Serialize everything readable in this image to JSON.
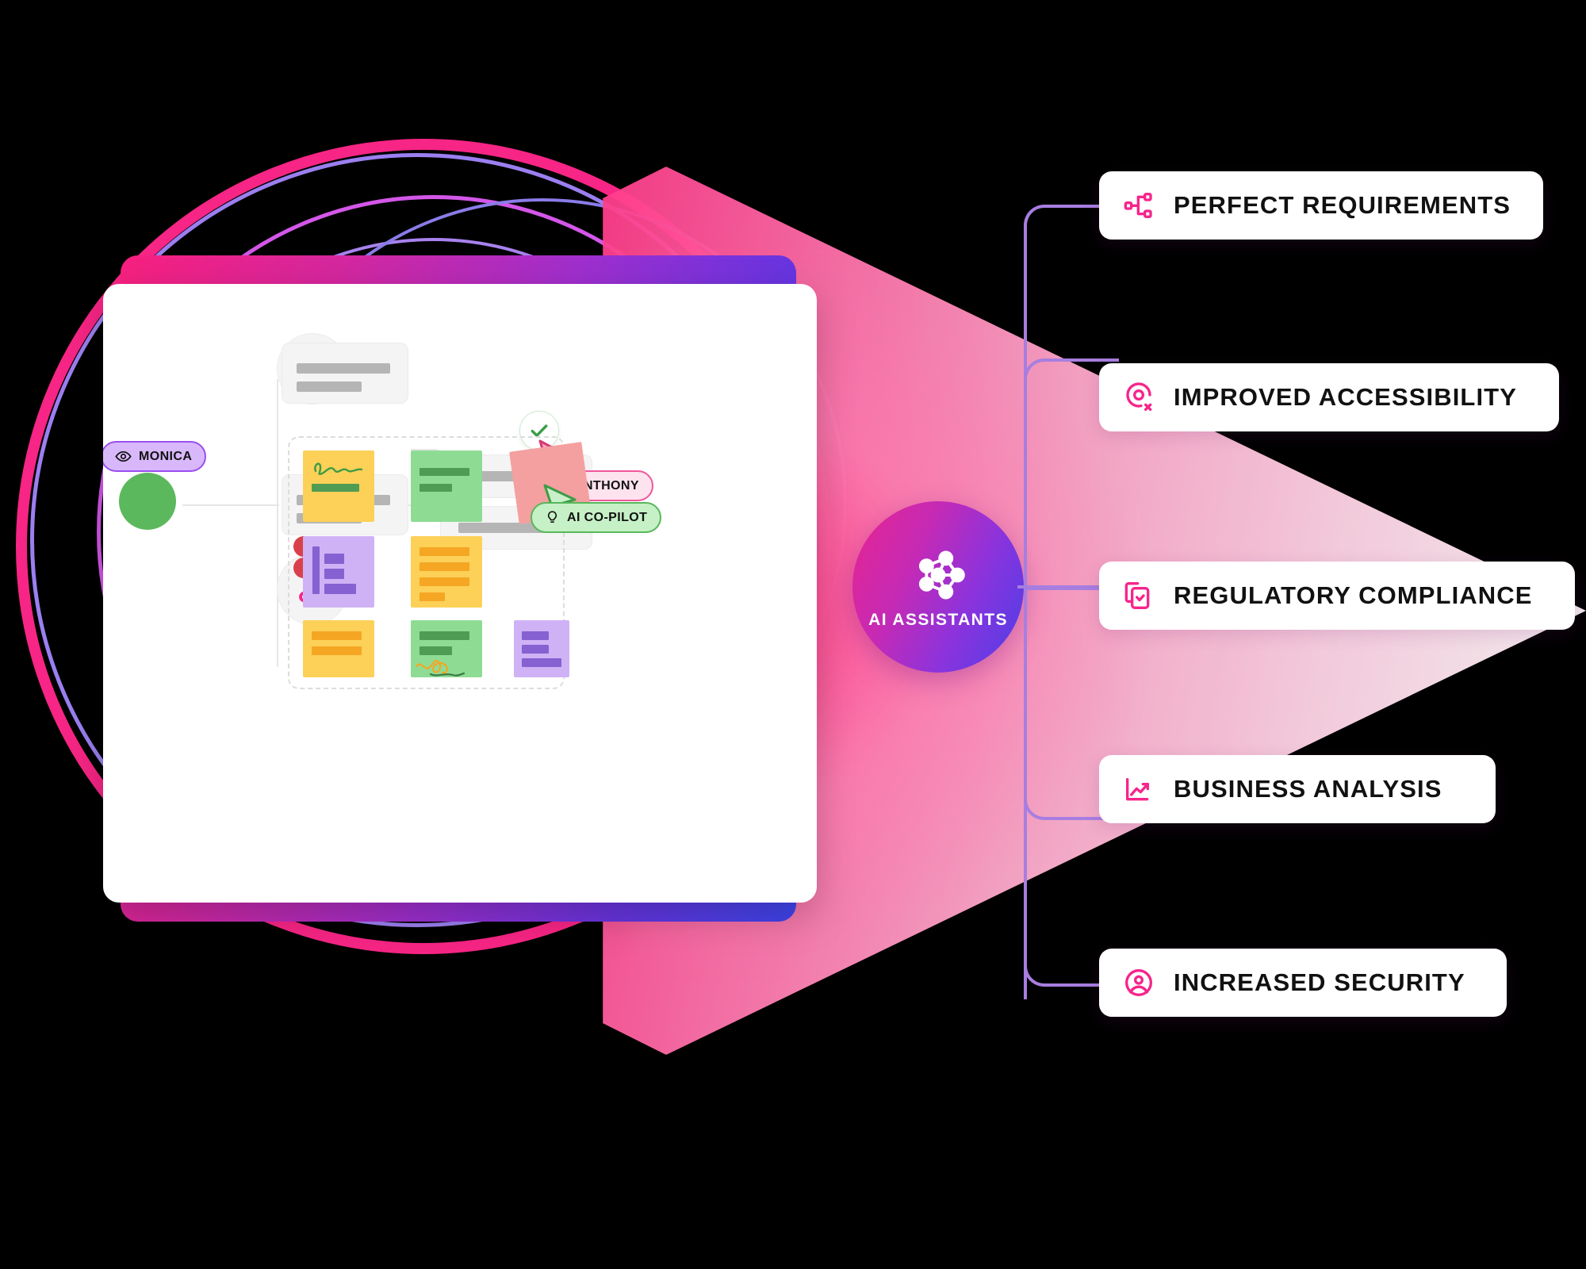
{
  "hero": {
    "center_node": {
      "label": "AI ASSISTANTS",
      "icon": "neural-network-icon",
      "gradient_from": "#e8248f",
      "gradient_to": "#4a3fe8"
    },
    "features": [
      {
        "label": "PERFECT REQUIREMENTS",
        "icon": "hierarchy-nodes-icon",
        "accent": "#f7248b"
      },
      {
        "label": "IMPROVED ACCESSIBILITY",
        "icon": "eye-pin-x-icon",
        "accent": "#f7248b"
      },
      {
        "label": "REGULATORY COMPLIANCE",
        "icon": "documents-check-icon",
        "accent": "#f7248b"
      },
      {
        "label": "BUSINESS ANALYSIS",
        "icon": "trending-up-chart-icon",
        "accent": "#f7248b"
      },
      {
        "label": "INCREASED SECURITY",
        "icon": "user-circle-icon",
        "accent": "#f7248b"
      }
    ],
    "connector_color": "#a77ee0",
    "beam_color": "#ff3d8b"
  },
  "board": {
    "collaborators": [
      {
        "name": "MONICA",
        "icon": "eye-icon",
        "fill": "#d8b8fa",
        "border": "#9a4ef0",
        "cursor_color": "#9a4ef0"
      },
      {
        "name": "ANTHONY",
        "icon": "none",
        "fill": "#fde3ee",
        "border": "#f0569b",
        "cursor_color": "#e0457f"
      },
      {
        "name": "AI CO-PILOT",
        "icon": "lightbulb-icon",
        "fill": "#c6f0c6",
        "border": "#56b85b",
        "cursor_color": "#56b85b"
      }
    ],
    "mindmap_nodes": [
      {
        "icon": "add-node-icon",
        "glyph": "+"
      },
      {
        "icon": "remove-node-icon",
        "glyph": "×"
      }
    ],
    "approval_icon": "green-check-icon",
    "sticky_notes": [
      {
        "color": "#fdd057",
        "name": "note-yellow-scribble",
        "bars": 1,
        "scribble": true
      },
      {
        "color": "#8edc94",
        "name": "note-green-text",
        "bars": 2,
        "scribble": false
      },
      {
        "color": "#f4a0a0",
        "name": "note-pink-tilted",
        "bars": 0,
        "scribble": false
      },
      {
        "color": "#ceb2f5",
        "name": "note-purple-chart",
        "bars": 3,
        "scribble": false
      },
      {
        "color": "#fdd057",
        "name": "note-yellow-list",
        "bars": 4,
        "scribble": false
      },
      {
        "color": "#fdd057",
        "name": "note-yellow-two-lines",
        "bars": 2,
        "scribble": false
      },
      {
        "color": "#8edc94",
        "name": "note-green-signature",
        "bars": 2,
        "scribble": true
      },
      {
        "color": "#ceb2f5",
        "name": "note-purple-bars",
        "bars": 3,
        "scribble": false
      }
    ],
    "comment_dots": 2
  },
  "window": {
    "back_card_gradient_from": "#f8207f",
    "back_card_gradient_to": "#3f45ee"
  }
}
